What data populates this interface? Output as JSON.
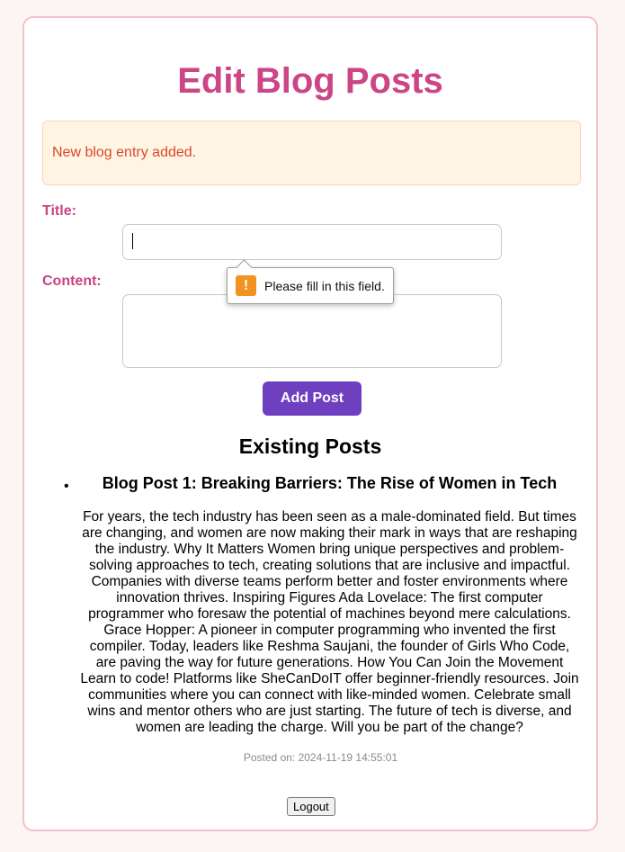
{
  "page": {
    "title": "Edit Blog Posts"
  },
  "alert": {
    "message": "New blog entry added."
  },
  "form": {
    "title_label": "Title:",
    "title_value": "",
    "content_label": "Content:",
    "content_value": "",
    "validation_message": "Please fill in this field.",
    "warning_icon": "warning-icon",
    "submit_label": "Add Post"
  },
  "posts_section": {
    "heading": "Existing Posts",
    "posts": [
      {
        "title": "Blog Post 1: Breaking Barriers: The Rise of Women in Tech",
        "content": "For years, the tech industry has been seen as a male-dominated field. But times are changing, and women are now making their mark in ways that are reshaping the industry. Why It Matters Women bring unique perspectives and problem-solving approaches to tech, creating solutions that are inclusive and impactful. Companies with diverse teams perform better and foster environments where innovation thrives. Inspiring Figures Ada Lovelace: The first computer programmer who foresaw the potential of machines beyond mere calculations. Grace Hopper: A pioneer in computer programming who invented the first compiler. Today, leaders like Reshma Saujani, the founder of Girls Who Code, are paving the way for future generations. How You Can Join the Movement Learn to code! Platforms like SheCanDoIT offer beginner-friendly resources. Join communities where you can connect with like-minded women. Celebrate small wins and mentor others who are just starting. The future of tech is diverse, and women are leading the charge. Will you be part of the change?",
        "posted_on": "Posted on: 2024-11-19 14:55:01"
      }
    ]
  },
  "footer": {
    "logout_label": "Logout"
  },
  "colors": {
    "heading_pink": "#cc4586",
    "button_purple": "#6e3fbf",
    "alert_background": "#fff5e2",
    "alert_text": "#d9482f",
    "warning_orange": "#f2931f"
  }
}
